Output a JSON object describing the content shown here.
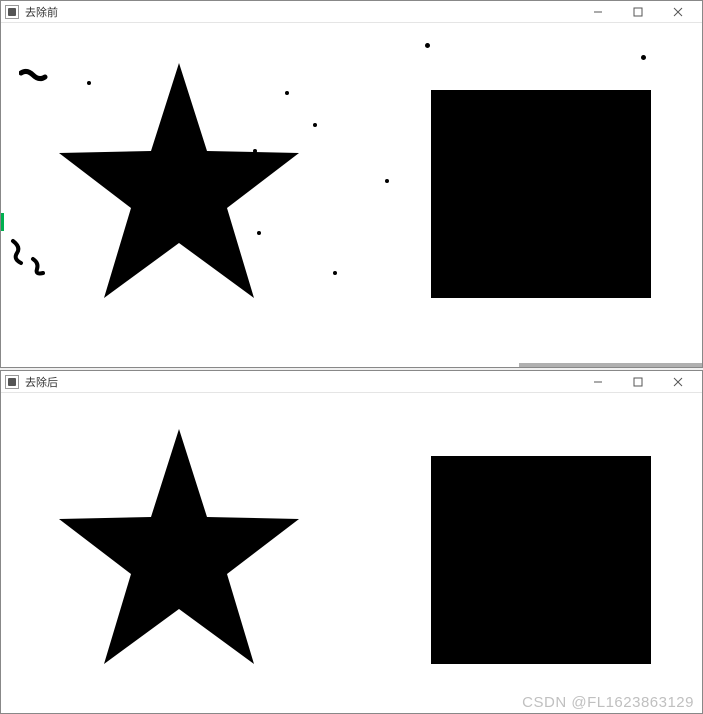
{
  "window1": {
    "title": "去除前",
    "icon": "image-icon",
    "buttons": {
      "min": "—",
      "max": "□",
      "close": "✕"
    }
  },
  "window2": {
    "title": "去除后",
    "icon": "image-icon",
    "buttons": {
      "min": "—",
      "max": "□",
      "close": "✕"
    }
  },
  "watermark": "CSDN @FL1623863129"
}
